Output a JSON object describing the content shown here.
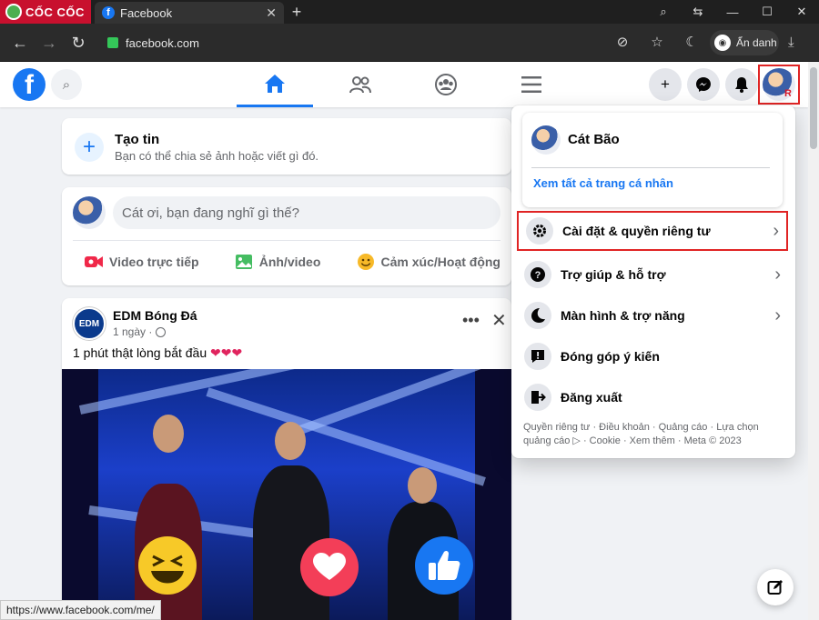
{
  "browser": {
    "brand": "CỐC CỐC",
    "tab_title": "Facebook",
    "tab_close": "✕",
    "new_tab": "+",
    "url": "facebook.com",
    "incognito_label": "Ẩn danh",
    "status_url": "https://www.facebook.com/me/"
  },
  "feed": {
    "create_story_title": "Tạo tin",
    "create_story_sub": "Bạn có thể chia sẻ ảnh hoặc viết gì đó.",
    "composer_placeholder": "Cát ơi, bạn đang nghĩ gì thế?",
    "actions": [
      "Video trực tiếp",
      "Ảnh/video",
      "Cảm xúc/Hoạt động"
    ],
    "post": {
      "author": "EDM Bóng Đá",
      "avatar_text": "EDM",
      "time": "1 ngày ·",
      "text": "1 phút thật lòng bắt đầu",
      "hearts": "❤❤❤"
    }
  },
  "menu": {
    "profile_name": "Cát Bão",
    "see_all_profiles": "Xem tất cả trang cá nhân",
    "items": [
      {
        "label": "Cài đặt & quyền riêng tư",
        "icon": "gear-icon",
        "chevron": true
      },
      {
        "label": "Trợ giúp & hỗ trợ",
        "icon": "help-icon",
        "chevron": true
      },
      {
        "label": "Màn hình & trợ năng",
        "icon": "moon-icon",
        "chevron": true
      },
      {
        "label": "Đóng góp ý kiến",
        "icon": "feedback-icon",
        "chevron": false
      },
      {
        "label": "Đăng xuất",
        "icon": "logout-icon",
        "chevron": false
      }
    ],
    "footer_line1": "Quyền riêng tư · Điều khoản · Quảng cáo · Lựa chọn",
    "footer_line2": "quảng cáo ▷ · Cookie · Xem thêm · Meta © 2023"
  },
  "colors": {
    "fb_blue": "#1877f2",
    "highlight_red": "#e02424",
    "coccoc_red": "#c8102e"
  }
}
